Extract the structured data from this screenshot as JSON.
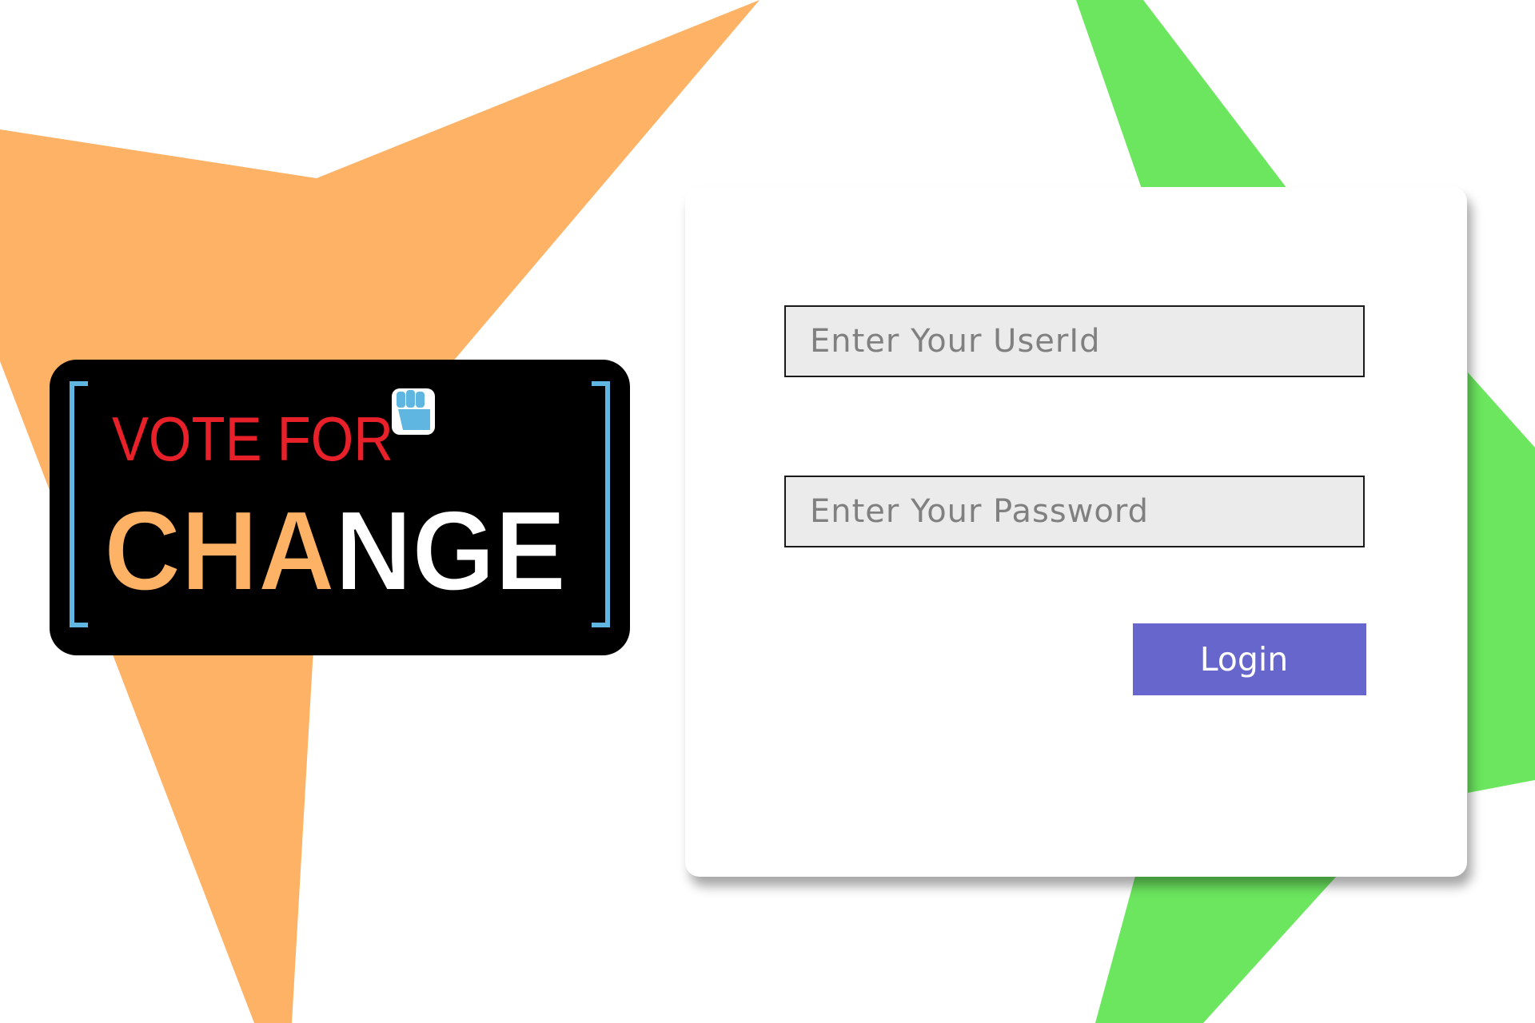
{
  "logo": {
    "line1": "VOTE FOR",
    "line2_orange": "CHA",
    "line2_white": "NGE",
    "colors": {
      "red": "#e8202a",
      "orange": "#fdb266",
      "white": "#ffffff",
      "outline": "#000000",
      "bracket": "#5fb6e0"
    }
  },
  "login_form": {
    "userid_placeholder": "Enter Your UserId",
    "password_placeholder": "Enter Your Password",
    "login_label": "Login"
  },
  "theme": {
    "orange_shape": "#fdb266",
    "green_shape": "#6ce65f",
    "button": "#6766cc",
    "field_bg": "#ebebeb"
  }
}
